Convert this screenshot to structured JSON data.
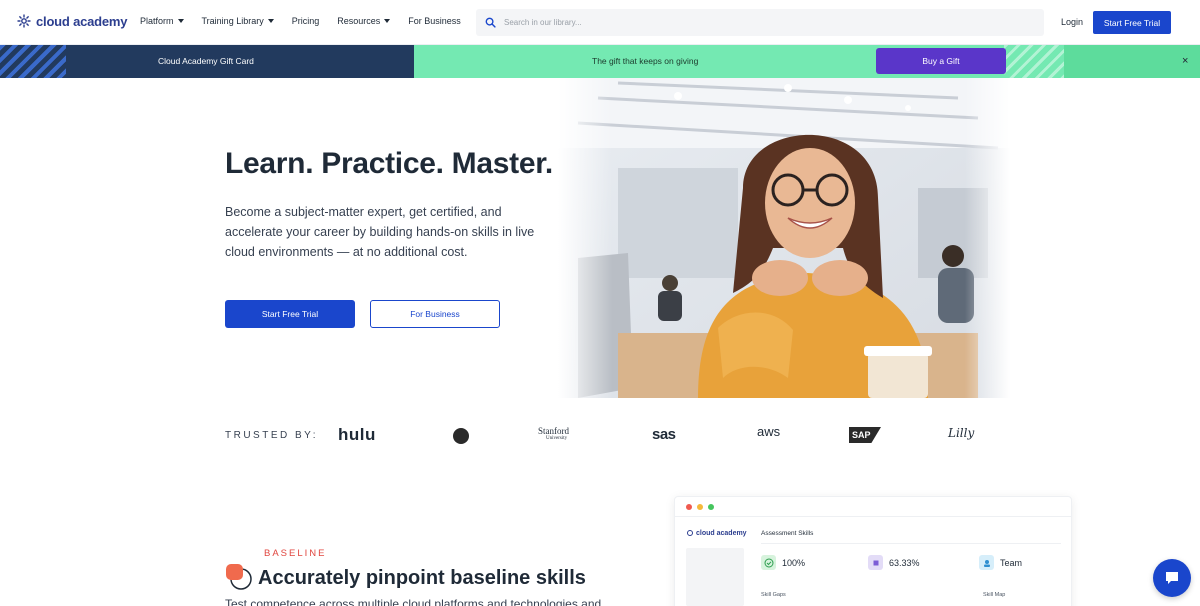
{
  "nav": {
    "brand": "cloud academy",
    "links": [
      "Platform",
      "Training Library",
      "Pricing",
      "Resources",
      "For Business"
    ],
    "search_placeholder": "Search in our library...",
    "login": "Login",
    "cta": "Start Free Trial"
  },
  "banner": {
    "left_text": "Cloud Academy Gift Card",
    "mid_text": "The gift that keeps on giving",
    "button": "Buy a Gift",
    "close": "×"
  },
  "hero": {
    "title": "Learn. Practice. Master.",
    "description": "Become a subject-matter expert, get certified, and accelerate your career by building hands-on skills in live cloud environments — at no additional cost.",
    "primary_button": "Start Free Trial",
    "secondary_button": "For Business"
  },
  "trusted": {
    "label": "TRUSTED BY:",
    "logos": [
      "hulu",
      "Stanford",
      "University",
      "sas",
      "aws",
      "SAP",
      "Lilly"
    ]
  },
  "baseline": {
    "kicker": "BASELINE",
    "title": "Accurately pinpoint baseline skills",
    "description": "Test competence across multiple cloud platforms and technologies and"
  },
  "preview": {
    "brand": "cloud academy",
    "heading": "Assessment Skills",
    "stat1": "100%",
    "stat2": "63.33%",
    "stat3": "Team",
    "sub1": "Skill Gaps",
    "sub2": "Skill Map"
  },
  "colors": {
    "brand_blue": "#1a46cc",
    "banner_dark": "#223a5e",
    "banner_green": "#74e9b2",
    "gift_purple": "#5a36c9",
    "kicker_red": "#e0463f"
  }
}
